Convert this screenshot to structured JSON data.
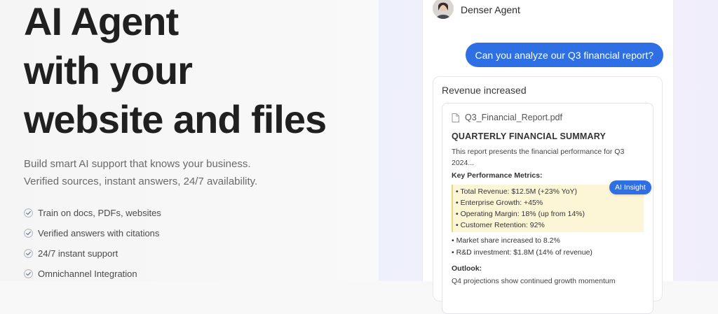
{
  "hero": {
    "headline_lines": [
      "AI Agent",
      "with your",
      "website and files"
    ],
    "subhead_lines": [
      "Build smart AI support that knows your business.",
      "Verified sources, instant answers, 24/7 availability."
    ],
    "features": [
      "Train on docs, PDFs, websites",
      "Verified answers with citations",
      "24/7 instant support",
      "Omnichannel Integration"
    ]
  },
  "chat": {
    "agent_name": "Denser Agent",
    "user_message": "Can you analyze our Q3 financial report?",
    "reply_title": "Revenue increased",
    "document": {
      "filename": "Q3_Financial_Report.pdf",
      "heading": "QUARTERLY FINANCIAL SUMMARY",
      "intro": "This report presents the financial performance for Q3 2024...",
      "metrics_title": "Key Performance Metrics:",
      "highlighted": [
        "• Total Revenue: $12.5M (+23% YoY)",
        "• Enterprise Growth: +45%",
        "• Operating Margin: 18% (up from 14%)",
        "• Customer Retention: 92%"
      ],
      "other": [
        "• Market share increased to 8.2%",
        "• R&D investment: $1.8M (14% of revenue)"
      ],
      "outlook_title": "Outlook:",
      "outlook_text": "Q4 projections show continued growth momentum"
    },
    "insight_badge": "AI Insight"
  },
  "colors": {
    "accent": "#2f6fe4",
    "highlight": "#fcf6d6",
    "check": "#8a93a6"
  },
  "icons": {
    "feature": "check-icon",
    "file": "file-icon",
    "avatar": "agent-avatar"
  }
}
